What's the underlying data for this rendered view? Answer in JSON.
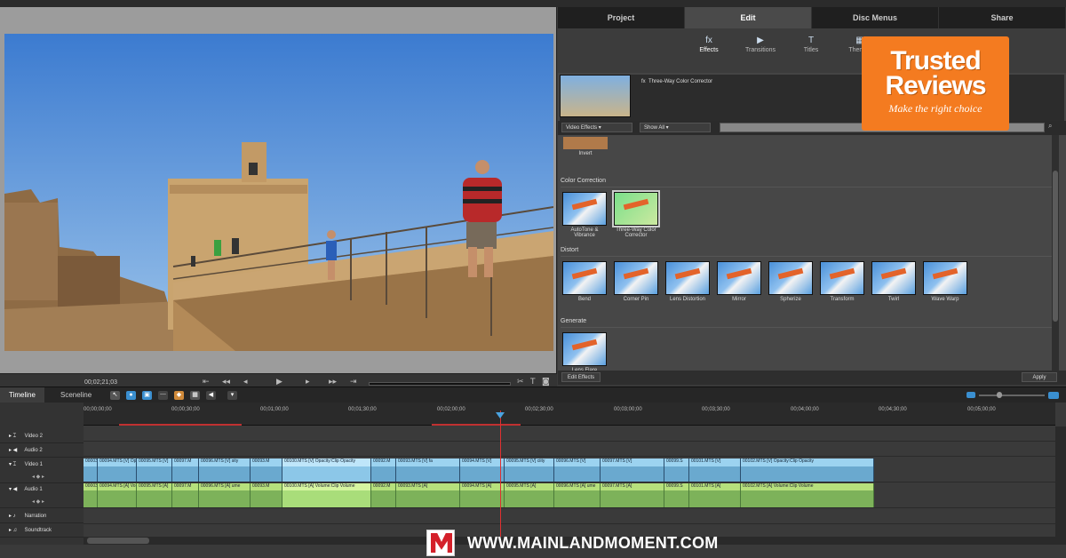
{
  "monitor": {
    "timecode": "00;02;21;03",
    "transport_icons": [
      "rewind-start-icon",
      "step-back-icon",
      "prev-frame-icon",
      "play-icon",
      "next-frame-icon",
      "step-forward-icon",
      "goto-end-icon"
    ],
    "tools": [
      "scissors-icon",
      "text-icon",
      "camera-icon"
    ]
  },
  "tabs": [
    "Project",
    "Edit",
    "Disc Menus",
    "Share"
  ],
  "active_tab": "Edit",
  "subtabs": [
    {
      "label": "Effects",
      "icon": "fx"
    },
    {
      "label": "Transitions",
      "icon": "▶"
    },
    {
      "label": "Titles",
      "icon": "T"
    },
    {
      "label": "Themes",
      "icon": "▦"
    }
  ],
  "preview": {
    "effect_label": "Three-Way Color Corrector",
    "fx": "fx"
  },
  "filters": {
    "category": "Video Effects",
    "show": "Show All"
  },
  "effects_panel": {
    "top_item": "Invert",
    "sections": [
      {
        "title": "Color Correction",
        "items": [
          "AutoTone & Vibrance",
          "Three-Way Color Corrector"
        ]
      },
      {
        "title": "Distort",
        "items": [
          "Bend",
          "Corner Pin",
          "Lens Distortion",
          "Mirror",
          "Spherize",
          "Transform",
          "Twirl",
          "Wave Warp"
        ]
      },
      {
        "title": "Generate",
        "items": [
          "Lens Flare"
        ]
      }
    ],
    "edit_button": "Edit Effects",
    "apply_button": "Apply"
  },
  "trusted": {
    "line1": "Trusted",
    "line2": "Reviews",
    "tagline": "Make the right choice"
  },
  "timeline": {
    "tabs": [
      "Timeline",
      "Sceneline"
    ],
    "ruler": [
      "00;00;00;00",
      "00;00;30;00",
      "00;01;00;00",
      "00;01;30;00",
      "00;02;00;00",
      "00;02;30;00",
      "00;03;00;00",
      "00;03;30;00",
      "00;04;00;00",
      "00;04;30;00",
      "00;05;00;00"
    ],
    "tracks": [
      "Video 2",
      "Audio 2",
      "Video 1",
      "Audio 1",
      "Narration",
      "Soundtrack"
    ],
    "video_clips": [
      "00003.",
      "00094.MTS [V] Opacity:Clip Opacity",
      "00095.MTS [V]",
      "00097.M",
      "00096.MTS [V] sity",
      "00093.M",
      "00100.MTS [V] Opacity:Clip Opacity",
      "00092.M",
      "00093.MTS [V] fa",
      "00094.MTS [V]",
      "00095.MTS [V] ciity",
      "00096.MTS [V]",
      "00097.MTS [V]",
      "00099.S",
      "00101.MTS [V]",
      "00102.MTS [V] Opacity:Clip Opacity"
    ],
    "audio_clips": [
      "00003.",
      "00094.MTS [A] Volume:Clip Volume",
      "00095.MTS [A]",
      "00097.M",
      "00096.MTS [A] ume",
      "00093.M",
      "00100.MTS [A] Volume:Clip Volume",
      "00092.M",
      "00093.MTS [A]",
      "00094.MTS [A]",
      "00095.MTS [A]",
      "00096.MTS [A] ume",
      "00097.MTS [A]",
      "00099.S",
      "00101.MTS [A]",
      "00102.MTS [A] Volume:Clip Volume"
    ]
  },
  "watermark": {
    "text": "WWW.MAINLANDMOMENT.COM"
  }
}
